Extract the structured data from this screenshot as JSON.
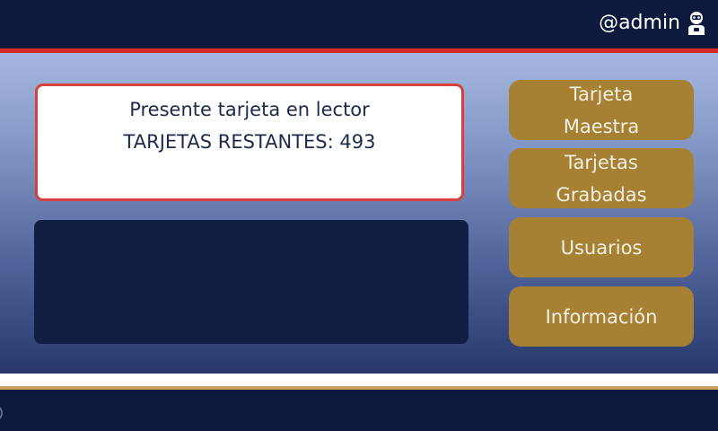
{
  "header": {
    "username": "@admin",
    "user_icon": "robot-user-icon"
  },
  "message": {
    "line1": "Presente tarjeta en lector",
    "line2": "TARJETAS RESTANTES: 493"
  },
  "menu": {
    "items": [
      {
        "line1": "Tarjeta",
        "line2": "Maestra"
      },
      {
        "line1": "Tarjetas",
        "line2": "Grabadas"
      },
      {
        "label": "Usuarios"
      },
      {
        "label": "Información"
      }
    ]
  },
  "colors": {
    "header_bg": "#0e1a3d",
    "accent_red": "#d42a2a",
    "button_gold": "#a68033",
    "gold_line": "#c7a158",
    "panel_dark": "#111e44"
  }
}
